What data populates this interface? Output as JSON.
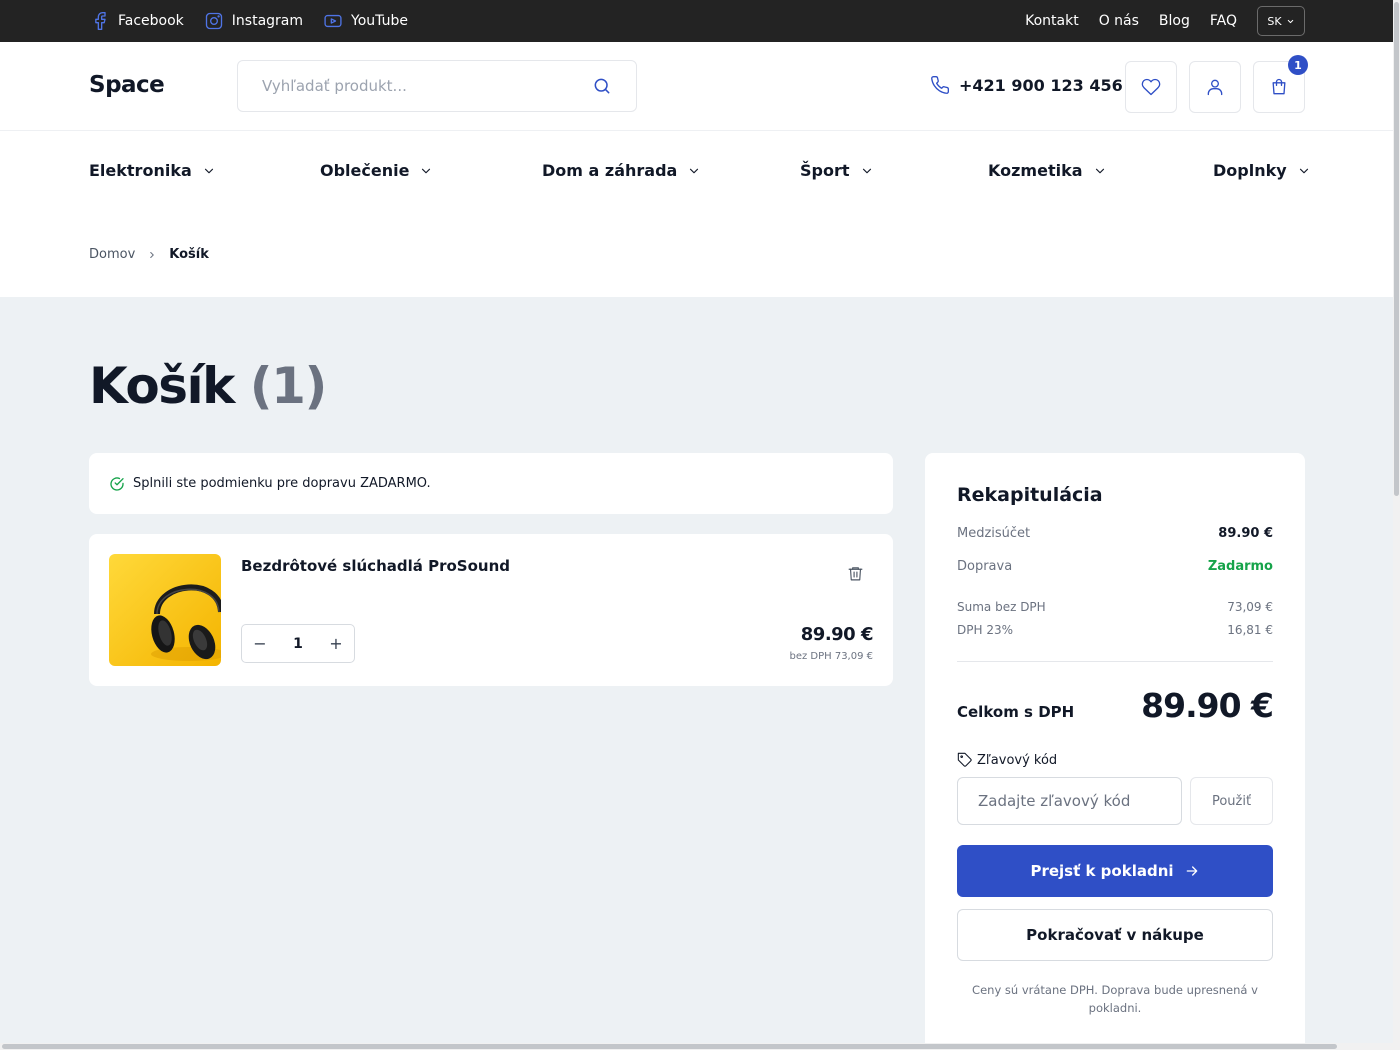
{
  "topbar": {
    "social": [
      {
        "label": "Facebook",
        "icon": "facebook-icon"
      },
      {
        "label": "Instagram",
        "icon": "instagram-icon"
      },
      {
        "label": "YouTube",
        "icon": "youtube-icon"
      }
    ],
    "links": [
      "Kontakt",
      "O nás",
      "Blog",
      "FAQ"
    ],
    "language": "SK"
  },
  "header": {
    "logo": "Space",
    "search_placeholder": "Vyhľadať produkt...",
    "phone": "+421 900 123 456",
    "cart_count": "1"
  },
  "nav": {
    "categories": [
      "Elektronika",
      "Oblečenie",
      "Dom a záhrada",
      "Šport",
      "Kozmetika",
      "Doplnky"
    ]
  },
  "breadcrumb": {
    "home": "Domov",
    "current": "Košík"
  },
  "page": {
    "title": "Košík",
    "count": "(1)"
  },
  "notice": {
    "text": "Splnili ste podmienku pre dopravu ZADARMO."
  },
  "cart": {
    "items": [
      {
        "name": "Bezdrôtové slúchadlá ProSound",
        "quantity": "1",
        "price": "89.90 €",
        "price_net": "bez DPH 73,09 €"
      }
    ]
  },
  "summary": {
    "title": "Rekapitulácia",
    "subtotal_label": "Medzisúčet",
    "subtotal_value": "89.90 €",
    "shipping_label": "Doprava",
    "shipping_value": "Zadarmo",
    "net_label": "Suma bez DPH",
    "net_value": "73,09 €",
    "vat_label": "DPH 23%",
    "vat_value": "16,81 €",
    "total_label": "Celkom s DPH",
    "total_value": "89.90 €",
    "discount_label": "Zľavový kód",
    "discount_placeholder": "Zadajte zľavový kód",
    "discount_button": "Použiť",
    "checkout_button": "Prejsť k pokladni",
    "continue_button": "Pokračovať v nákupe",
    "note": "Ceny sú vrátane DPH. Doprava bude upresnená v pokladni."
  },
  "colors": {
    "topbar_bg": "#232323",
    "accent": "#2f4fc6",
    "success": "#16a34a",
    "page_bg": "#edf1f4"
  }
}
